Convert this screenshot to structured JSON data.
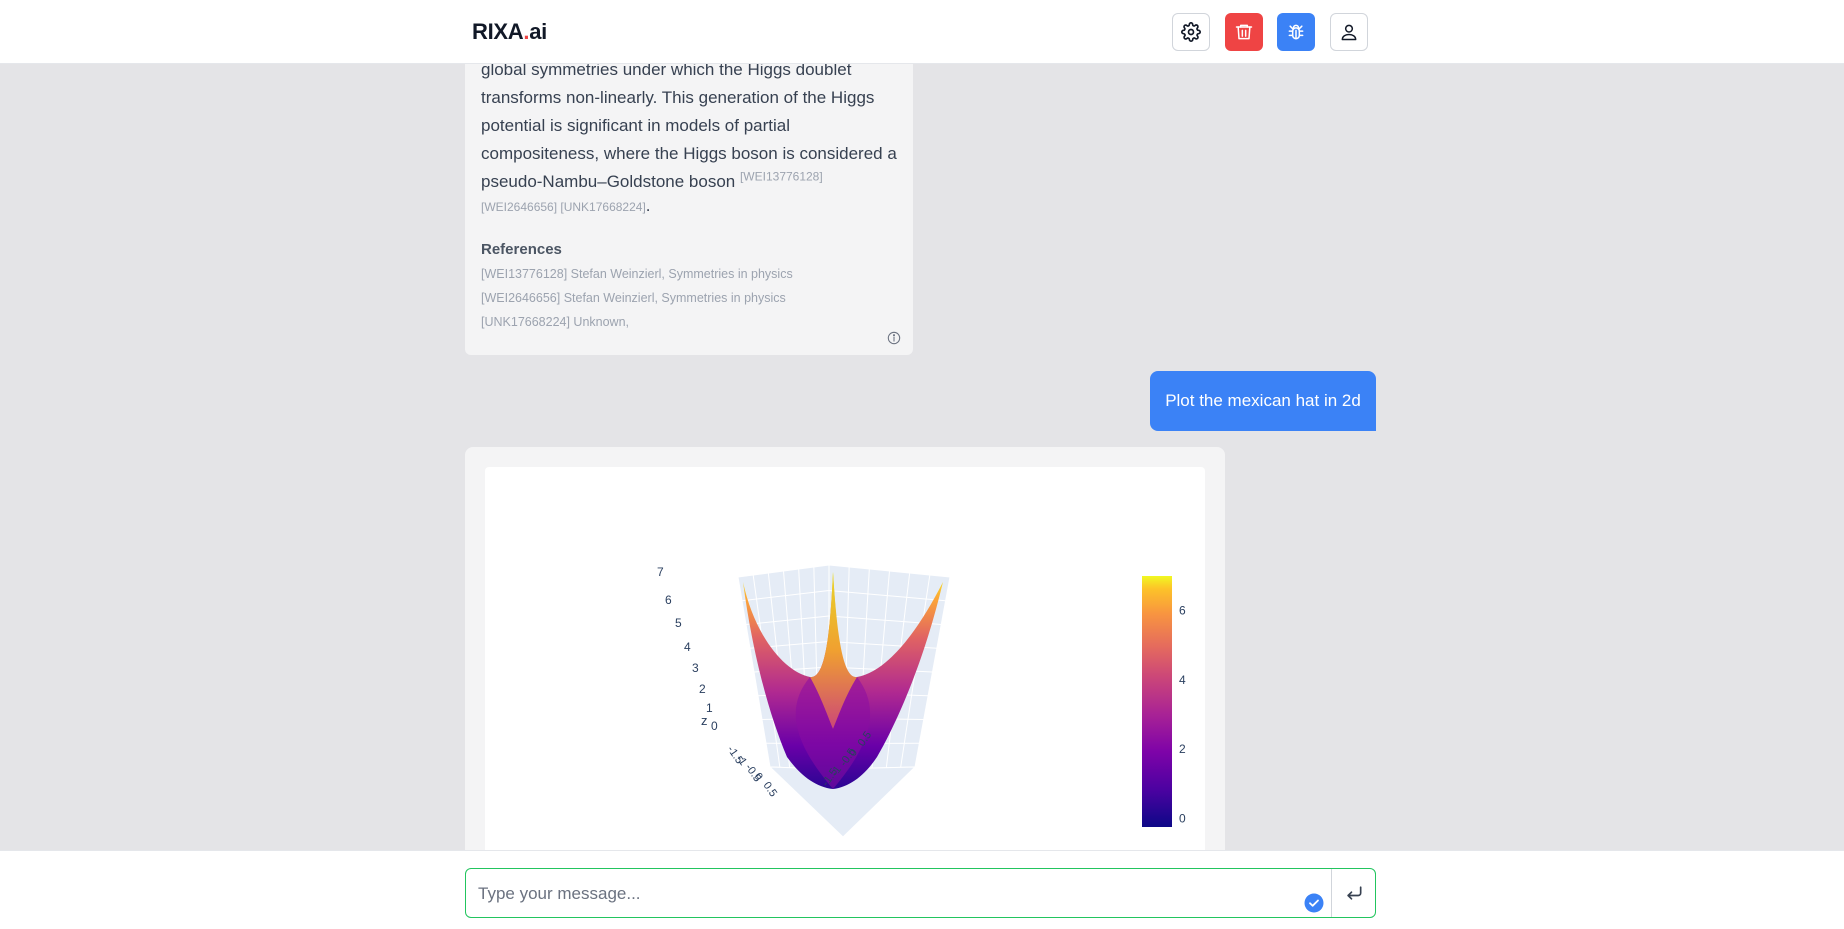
{
  "header": {
    "brand": "RIXA",
    "brand_dot": ".",
    "brand_suffix": "ai",
    "icons": [
      "gear-icon",
      "trash-icon",
      "bug-icon",
      "user-icon"
    ]
  },
  "assistant_message": {
    "line1": "global symmetries under which the Higgs doublet",
    "line2": "transforms non-linearly. This generation of the Higgs",
    "line3": "potential is significant in models of partial",
    "line4": "compositeness, where the Higgs boson is considered a",
    "line5": "pseudo-Nambu–Goldstone boson",
    "cite1": "[WEI13776128]",
    "cite2": "[WEI2646656] [UNK17668224]",
    "period": ".",
    "references_title": "References",
    "references": [
      "[WEI13776128] Stefan Weinzierl, Symmetries in physics",
      "[WEI2646656] Stefan Weinzierl, Symmetries in physics",
      "[UNK17668224] Unknown,"
    ]
  },
  "user_message": "Plot the mexican hat in 2d",
  "composer": {
    "placeholder": "Type your message..."
  },
  "chart_data": {
    "type": "surface",
    "z_axis": {
      "label": "z",
      "ticks": [
        "0",
        "1",
        "2",
        "3",
        "4",
        "5",
        "6",
        "7"
      ]
    },
    "x_axis_ticks": [
      "-1.5",
      "-1",
      "-0.5",
      "0",
      "0.5"
    ],
    "y_axis_ticks": [
      "-1.5",
      "-1",
      "-0.5",
      "0",
      "0.5"
    ],
    "colorbar": {
      "ticks": [
        "0",
        "2",
        "4",
        "6"
      ],
      "range": [
        -0.25,
        7
      ],
      "colorscale": "plasma"
    },
    "z_range": [
      -0.25,
      7
    ]
  }
}
